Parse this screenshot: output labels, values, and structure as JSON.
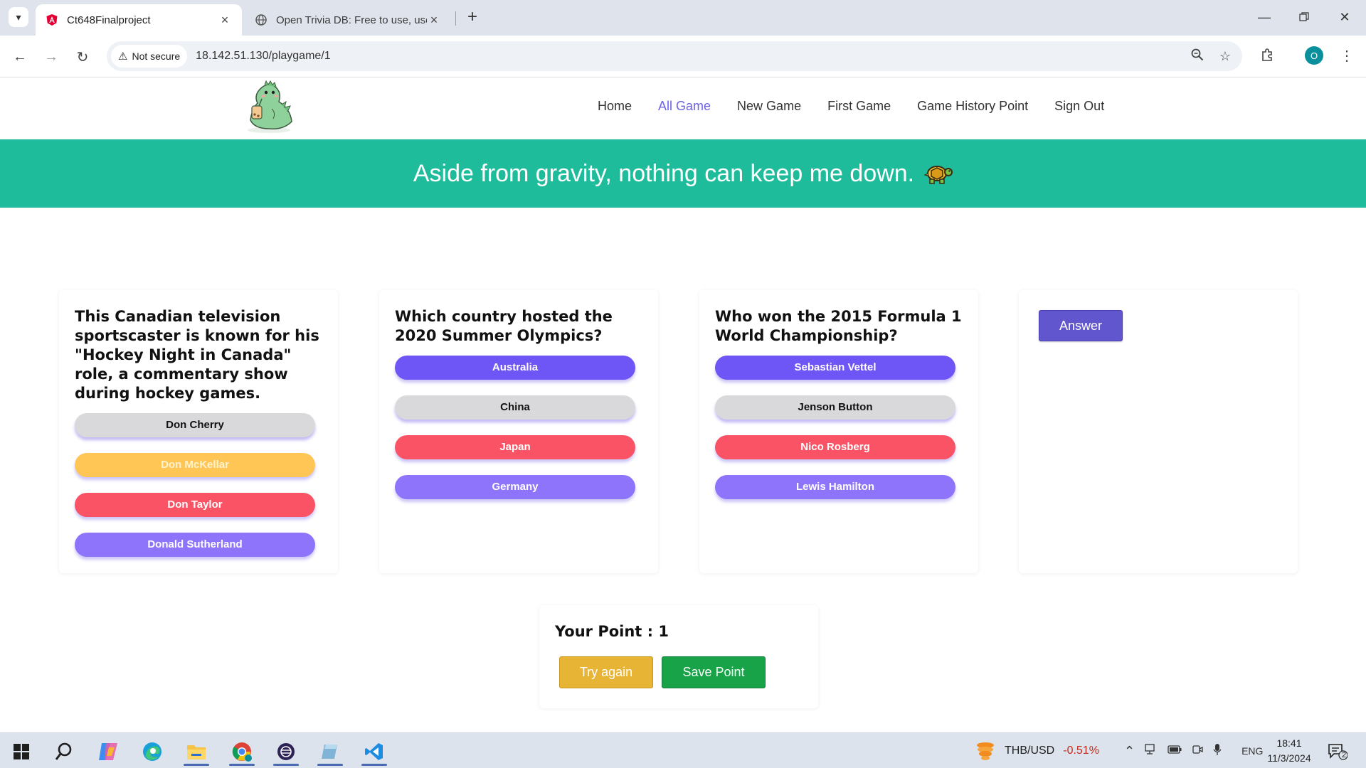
{
  "browser": {
    "tabs": [
      {
        "title": "Ct648Finalproject",
        "active": true
      },
      {
        "title": "Open Trivia DB: Free to use, use",
        "active": false
      }
    ],
    "security_label": "Not secure",
    "url": "18.142.51.130/playgame/1",
    "profile_initial": "O"
  },
  "site": {
    "nav": [
      "Home",
      "All Game",
      "New Game",
      "First Game",
      "Game History Point",
      "Sign Out"
    ],
    "active_nav": "All Game",
    "banner": "Aside from gravity, nothing can keep me down."
  },
  "questions": [
    {
      "text": "This Canadian television sportscaster is known for his \"Hockey Night in Canada\" role, a commentary show during hockey games.",
      "options": [
        "Don Cherry",
        "Don McKellar",
        "Don Taylor",
        "Donald Sutherland"
      ]
    },
    {
      "text": "Which country hosted the 2020 Summer Olympics?",
      "options": [
        "Australia",
        "China",
        "Japan",
        "Germany"
      ]
    },
    {
      "text": "Who won the 2015 Formula 1 World Championship?",
      "options": [
        "Sebastian Vettel",
        "Jenson Button",
        "Nico Rosberg",
        "Lewis Hamilton"
      ]
    }
  ],
  "answer_button": "Answer",
  "points": {
    "title": "Your Point : 1",
    "try_again": "Try again",
    "save": "Save Point"
  },
  "taskbar": {
    "ticker_symbol": "THB/USD",
    "ticker_change": "-0.51%",
    "language": "ENG",
    "time": "18:41",
    "date": "11/3/2024",
    "notifications": "2"
  },
  "colors": {
    "banner": "#1fbc9c",
    "option_purple": "#6e55f5",
    "option_gray": "#d9d9dc",
    "option_red": "#fa5365",
    "option_yellow": "#ffc655",
    "option_lavender": "#8d74fb",
    "answer_button": "#6256cf",
    "try_again": "#e8b436",
    "save_point": "#18a348",
    "active_nav": "#6c63e6"
  }
}
